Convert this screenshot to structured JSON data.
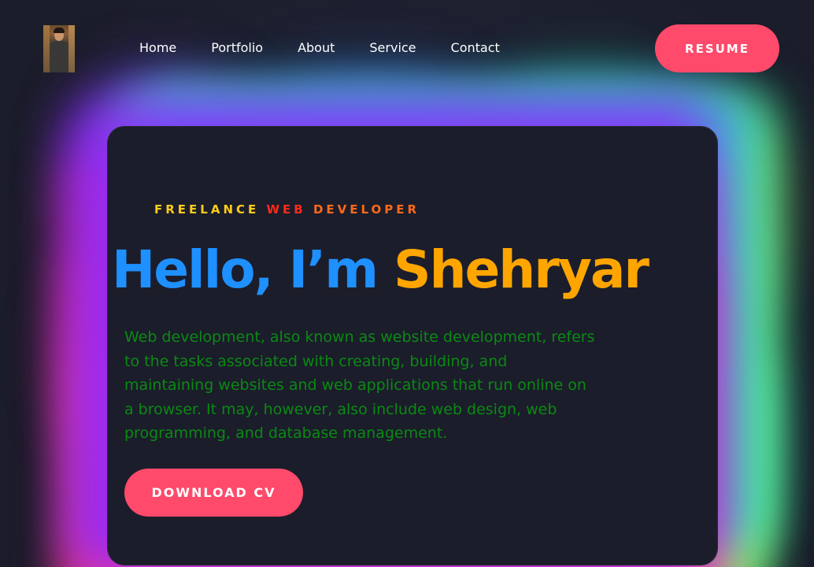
{
  "nav": {
    "items": [
      "Home",
      "Portfolio",
      "About",
      "Service",
      "Contact"
    ],
    "resume_label": "RESUME"
  },
  "hero": {
    "subtitle_part1": "FREELANCE ",
    "subtitle_part2": "WEB ",
    "subtitle_part3": "DEVELOPER",
    "hello": "Hello, I’m ",
    "name": "Shehryar",
    "description": "Web development, also known as website development, refers to the tasks associated with creating, building, and maintaining websites and web applications that run online on a browser. It may, however, also include web design, web programming, and database management.",
    "download_label": "DOWNLOAD CV"
  },
  "colors": {
    "background": "#1b1d2a",
    "accent_button": "#ff4a6b",
    "hello_blue": "#1e90ff",
    "name_orange": "#ffa500",
    "description_green": "#0a8a12",
    "subtitle_yellow": "#ffcc1a",
    "subtitle_red": "#ff2a1a"
  }
}
